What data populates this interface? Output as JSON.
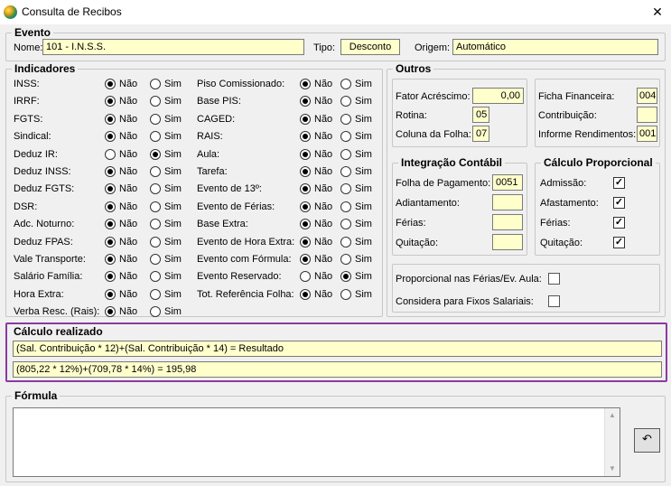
{
  "window": {
    "title": "Consulta de Recibos",
    "close_glyph": "✕"
  },
  "evento": {
    "group_title": "Evento",
    "nome_label": "Nome:",
    "nome_value": "101 - I.N.S.S.",
    "tipo_label": "Tipo:",
    "tipo_value": "Desconto",
    "origem_label": "Origem:",
    "origem_value": "Automático"
  },
  "indicadores": {
    "group_title": "Indicadores",
    "nao_label": "Não",
    "sim_label": "Sim",
    "left": [
      {
        "label": "INSS:",
        "selected": "nao"
      },
      {
        "label": "IRRF:",
        "selected": "nao"
      },
      {
        "label": "FGTS:",
        "selected": "nao"
      },
      {
        "label": "Sindical:",
        "selected": "nao"
      },
      {
        "label": "Deduz IR:",
        "selected": "sim"
      },
      {
        "label": "Deduz INSS:",
        "selected": "nao"
      },
      {
        "label": "Deduz FGTS:",
        "selected": "nao"
      },
      {
        "label": "DSR:",
        "selected": "nao"
      },
      {
        "label": "Adc. Noturno:",
        "selected": "nao"
      },
      {
        "label": "Deduz FPAS:",
        "selected": "nao"
      },
      {
        "label": "Vale Transporte:",
        "selected": "nao"
      },
      {
        "label": "Salário Família:",
        "selected": "nao"
      },
      {
        "label": "Hora Extra:",
        "selected": "nao"
      },
      {
        "label": "Verba Resc. (Rais):",
        "selected": "nao"
      }
    ],
    "right": [
      {
        "label": "Piso Comissionado:",
        "selected": "nao"
      },
      {
        "label": "Base PIS:",
        "selected": "nao"
      },
      {
        "label": "CAGED:",
        "selected": "nao"
      },
      {
        "label": "RAIS:",
        "selected": "nao"
      },
      {
        "label": "Aula:",
        "selected": "nao"
      },
      {
        "label": "Tarefa:",
        "selected": "nao"
      },
      {
        "label": "Evento de 13º:",
        "selected": "nao"
      },
      {
        "label": "Evento de Férias:",
        "selected": "nao"
      },
      {
        "label": "Base Extra:",
        "selected": "nao"
      },
      {
        "label": "Evento de Hora Extra:",
        "selected": "nao"
      },
      {
        "label": "Evento com Fórmula:",
        "selected": "nao"
      },
      {
        "label": "Evento Reservado:",
        "selected": "sim"
      },
      {
        "label": "Tot. Referência Folha:",
        "selected": "nao"
      }
    ]
  },
  "outros": {
    "group_title": "Outros",
    "fator_label": "Fator Acréscimo:",
    "fator_value": "0,00",
    "rotina_label": "Rotina:",
    "rotina_value": "05",
    "coluna_label": "Coluna da Folha:",
    "coluna_value": "07",
    "ficha_label": "Ficha Financeira:",
    "ficha_value": "004",
    "contrib_label": "Contribuição:",
    "contrib_value": "",
    "informe_label": "Informe Rendimentos:",
    "informe_value": "001"
  },
  "integracao": {
    "group_title": "Integração Contábil",
    "folha_label": "Folha de Pagamento:",
    "folha_value": "0051",
    "adiant_label": "Adiantamento:",
    "adiant_value": "",
    "ferias_label": "Férias:",
    "ferias_value": "",
    "quitacao_label": "Quitação:",
    "quitacao_value": ""
  },
  "proporcional": {
    "group_title": "Cálculo Proporcional",
    "items": [
      {
        "label": "Admissão:",
        "checked": true
      },
      {
        "label": "Afastamento:",
        "checked": true
      },
      {
        "label": "Férias:",
        "checked": true
      },
      {
        "label": "Quitação:",
        "checked": true
      }
    ]
  },
  "extras": {
    "prop_ferias_label": "Proporcional nas Férias/Ev. Aula:",
    "prop_ferias_checked": false,
    "fixos_label": "Considera para Fixos Salariais:",
    "fixos_checked": false
  },
  "calculo": {
    "group_title": "Cálculo realizado",
    "formula_line": "(Sal. Contribuição * 12)+(Sal. Contribuição * 14) = Resultado",
    "values_line": "(805,22 * 12%)+(709,78 * 14%) = 195,98"
  },
  "formula": {
    "group_title": "Fórmula",
    "text": ""
  },
  "undo_button": {
    "glyph": "↶"
  }
}
